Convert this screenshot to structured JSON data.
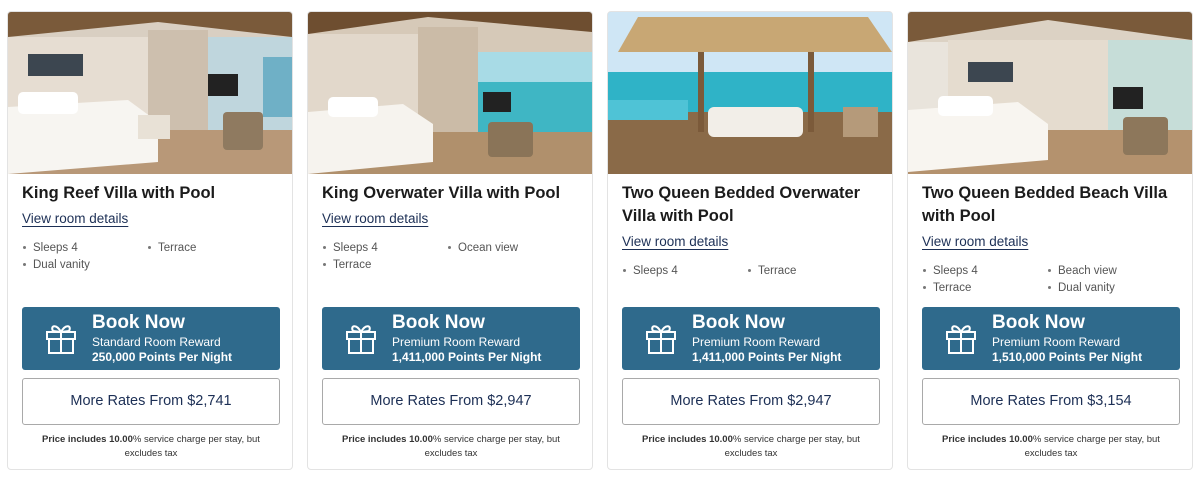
{
  "brand_color": "#2f6a8c",
  "link_color": "#1c2f55",
  "cards": [
    {
      "title": "King Reef Villa with Pool",
      "details_link": "View room details",
      "amenities": [
        "Sleeps 4",
        "Terrace",
        "Dual vanity"
      ],
      "book_label": "Book Now",
      "reward_type": "Standard Room Reward",
      "points": "250,000 Points Per Night",
      "rates_label": "More Rates From $2,741",
      "note_bold": "Price includes 10.00",
      "note_rest": "% service charge per stay, but excludes tax",
      "image": "villa-bedroom-photo"
    },
    {
      "title": "King Overwater Villa with Pool",
      "details_link": "View room details",
      "amenities": [
        "Sleeps 4",
        "Ocean view",
        "Terrace"
      ],
      "book_label": "Book Now",
      "reward_type": "Premium Room Reward",
      "points": "1,411,000 Points Per Night",
      "rates_label": "More Rates From $2,947",
      "note_bold": "Price includes 10.00",
      "note_rest": "% service charge per stay, but excludes tax",
      "image": "overwater-bedroom-photo"
    },
    {
      "title": "Two Queen Bedded Overwater Villa with Pool",
      "details_link": "View room details",
      "amenities": [
        "Sleeps 4",
        "Terrace"
      ],
      "book_label": "Book Now",
      "reward_type": "Premium Room Reward",
      "points": "1,411,000 Points Per Night",
      "rates_label": "More Rates From $2,947",
      "note_bold": "Price includes 10.00",
      "note_rest": "% service charge per stay, but excludes tax",
      "image": "overwater-deck-swing-photo"
    },
    {
      "title": "Two Queen Bedded Beach Villa with Pool",
      "details_link": "View room details",
      "amenities": [
        "Sleeps 4",
        "Beach view",
        "Terrace",
        "Dual vanity"
      ],
      "book_label": "Book Now",
      "reward_type": "Premium Room Reward",
      "points": "1,510,000 Points Per Night",
      "rates_label": "More Rates From $3,154",
      "note_bold": "Price includes 10.00",
      "note_rest": "% service charge per stay, but excludes tax",
      "image": "beach-villa-bedroom-photo"
    }
  ]
}
